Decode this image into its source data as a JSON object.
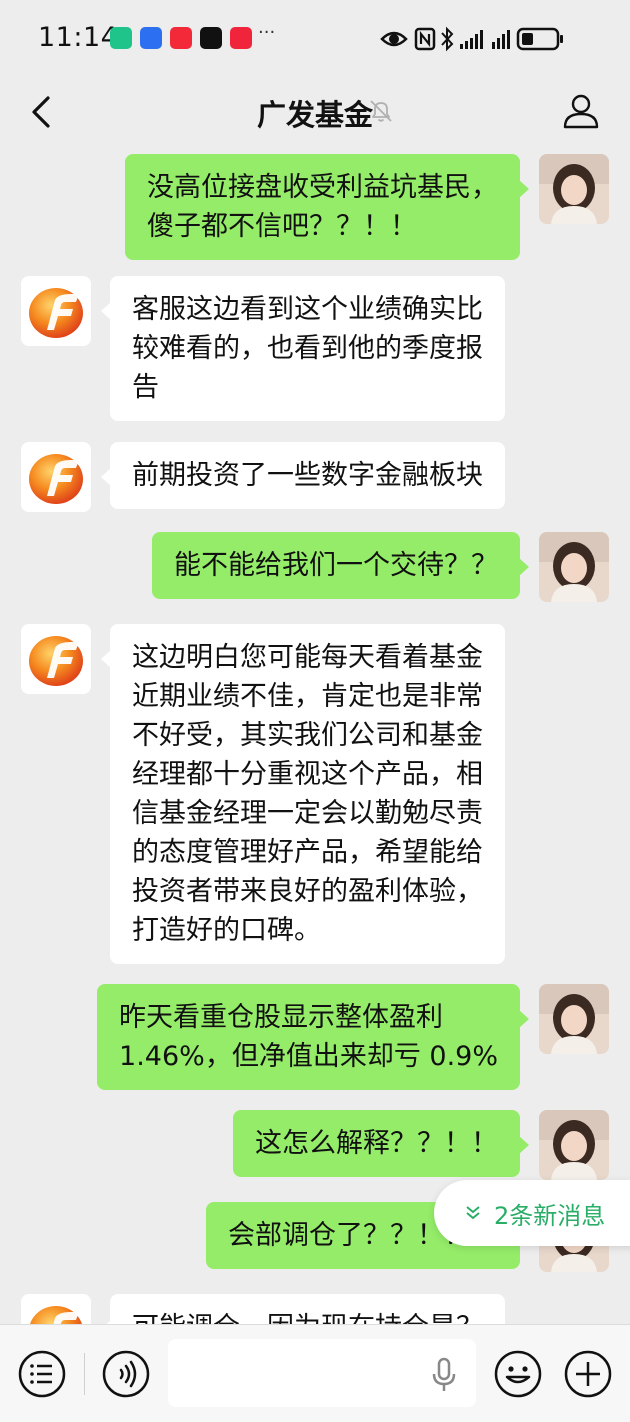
{
  "status_bar": {
    "time": "11:14",
    "more": "···",
    "app_icons": [
      {
        "name": "app-green-icon",
        "color": "#1fc48a"
      },
      {
        "name": "app-blue-icon",
        "color": "#2c6ff0"
      },
      {
        "name": "app-red-video-icon",
        "color": "#f3293a"
      },
      {
        "name": "app-capcut-icon",
        "color": "#111111"
      },
      {
        "name": "app-red-shop-icon",
        "color": "#f0243a"
      }
    ],
    "battery_level": 0.35
  },
  "nav": {
    "title": "广发基金"
  },
  "messages": [
    {
      "side": "right",
      "text": "没高位接盘收受利益坑基民，\n傻子都不信吧？？！！"
    },
    {
      "side": "left",
      "text": "客服这边看到这个业绩确实比\n较难看的，也看到他的季度报\n告"
    },
    {
      "side": "left",
      "text": "前期投资了一些数字金融板块"
    },
    {
      "side": "right",
      "text": "能不能给我们一个交待？？"
    },
    {
      "side": "left",
      "text": "这边明白您可能每天看着基金\n近期业绩不佳，肯定也是非常\n不好受，其实我们公司和基金\n经理都十分重视这个产品，相\n信基金经理一定会以勤勉尽责\n的态度管理好产品，希望能给\n投资者带来良好的盈利体验，\n打造好的口碑。"
    },
    {
      "side": "right",
      "text": "昨天看重仓股显示整体盈利\n1.46%，但净值出来却亏 0.9%"
    },
    {
      "side": "right",
      "text": "这怎么解释？？！！"
    },
    {
      "side": "right",
      "text": "会部调仓了？？！！！"
    },
    {
      "side": "left",
      "text": "可能调仓，因为现在持仓是？"
    }
  ],
  "new_messages": {
    "label": "2条新消息"
  },
  "input": {
    "placeholder": ""
  },
  "colors": {
    "background": "#ededed",
    "bubble_self": "#95ec69",
    "bubble_other": "#ffffff",
    "new_message_text": "#2aae67"
  }
}
